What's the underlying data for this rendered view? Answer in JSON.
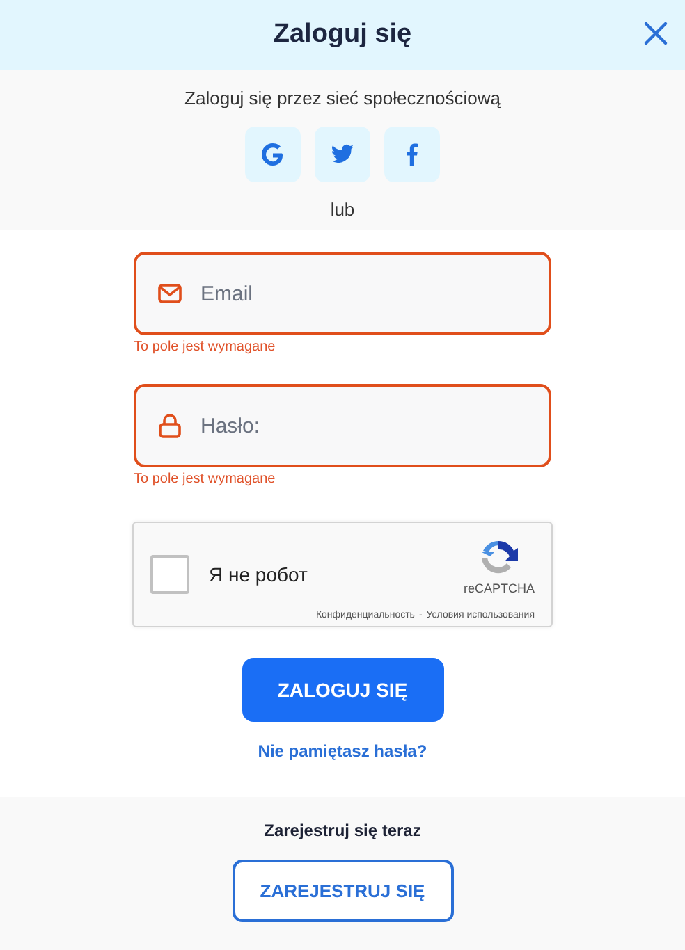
{
  "window": {
    "title": "Zaloguj się"
  },
  "social": {
    "prompt": "Zaloguj się przez sieć społecznościową",
    "buttons": [
      {
        "kind": "google"
      },
      {
        "kind": "twitter"
      },
      {
        "kind": "facebook"
      }
    ],
    "separator": "lub"
  },
  "fields": [
    {
      "kind": "email",
      "placeholder": "Email",
      "invalid": true,
      "error": "To pole jest wymagane"
    },
    {
      "kind": "password",
      "placeholder": "Hasło:",
      "invalid": true,
      "error": "To pole jest wymagane"
    }
  ],
  "captcha": {
    "label": "Я не робот",
    "checked": false,
    "brand": "reCAPTCHA",
    "privacy": "Конфиденциальность",
    "separator": "-",
    "terms": "Условия использования"
  },
  "login_button": "ZALOGUJ SIĘ",
  "forgot_link": "Nie pamiętasz hasła?",
  "register": {
    "prompt": "Zarejestruj się teraz",
    "button": "ZAREJESTRUJ SIĘ"
  }
}
